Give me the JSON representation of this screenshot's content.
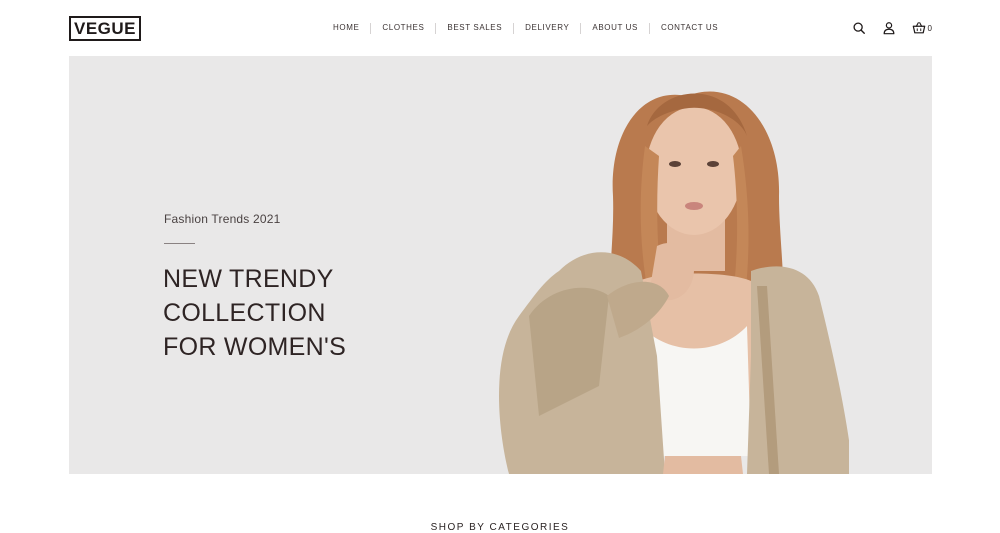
{
  "brand": {
    "logo_text": "VEGUE"
  },
  "nav": {
    "items": [
      {
        "label": "HOME"
      },
      {
        "label": "CLOTHES"
      },
      {
        "label": "BEST SALES"
      },
      {
        "label": "DELIVERY"
      },
      {
        "label": "ABOUT US"
      },
      {
        "label": "CONTACT US"
      }
    ]
  },
  "header_icons": {
    "search": "search-icon",
    "account": "user-icon",
    "cart": "basket-icon",
    "cart_count": "0"
  },
  "hero": {
    "subtitle": "Fashion Trends 2021",
    "title_line1": "NEW TRENDY COLLECTION",
    "title_line2": "FOR WOMEN'S",
    "background_color": "#e9e8e8"
  },
  "sections": {
    "categories_heading": "SHOP BY CATEGORIES"
  }
}
